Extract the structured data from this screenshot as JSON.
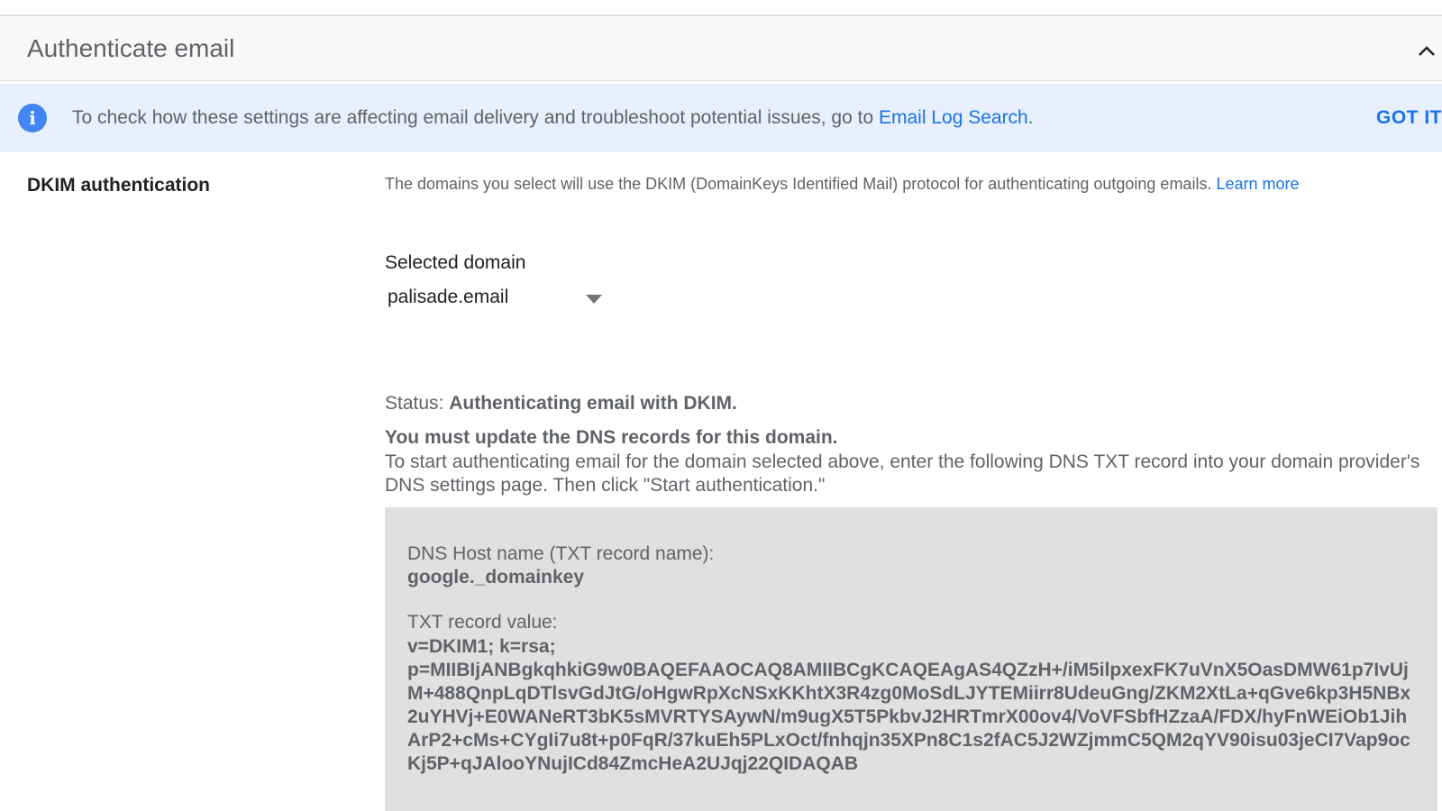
{
  "section": {
    "title": "Authenticate email"
  },
  "banner": {
    "text": "To check how these settings are affecting email delivery and troubleshoot potential issues, go to ",
    "link": "Email Log Search",
    "suffix": ".",
    "dismiss": "GOT IT"
  },
  "dkim": {
    "label": "DKIM authentication",
    "description": "The domains you select will use the DKIM (DomainKeys Identified Mail) protocol for authenticating outgoing emails. ",
    "learn_more": "Learn more",
    "selected_domain_label": "Selected domain",
    "selected_domain_value": "palisade.email",
    "status_prefix": "Status: ",
    "status_value": "Authenticating email with DKIM.",
    "warning": "You must update the DNS records for this domain.",
    "instructions": "To start authenticating email for the domain selected above, enter the following DNS TXT record into your domain provider's DNS settings page. Then click \"Start authentication.\"",
    "dns_host_label": "DNS Host name (TXT record name):",
    "dns_host_value": "google._domainkey",
    "txt_label": "TXT record value:",
    "txt_value_line1": "v=DKIM1; k=rsa;",
    "txt_value_line2": "p=MIIBIjANBgkqhkiG9w0BAQEFAAOCAQ8AMIIBCgKCAQEAgAS4QZzH+/iM5ilpxexFK7uVnX5OasDMW61p7IvUjM+488QnpLqDTlsvGdJtG/oHgwRpXcNSxKKhtX3R4zg0MoSdLJYTEMiirr8UdeuGng/ZKM2XtLa+qGve6kp3H5NBx2uYHVj+E0WANeRT3bK5sMVRTYSAywN/m9ugX5T5PkbvJ2HRTmrX00ov4/VoVFSbfHZzaA/FDX/hyFnWEiOb1JihArP2+cMs+CYgIi7u8t+p0FqR/37kuEh5PLxOct/fnhqjn35XPn8C1s2fAC5J2WZjmmC5QM2qYV90isu03jeCI7Vap9ocKj5P+qJAlooYNujICd84ZmcHeA2UJqj22QIDAQAB"
  },
  "colors": {
    "accent": "#1a73e8",
    "banner_bg": "#e8f0fe",
    "record_box_bg": "#e0e0e0",
    "info_icon": "#4285f4"
  },
  "icons": {
    "collapse": "chevron-up-icon",
    "info": "info-icon",
    "dropdown": "dropdown-arrow-icon"
  }
}
